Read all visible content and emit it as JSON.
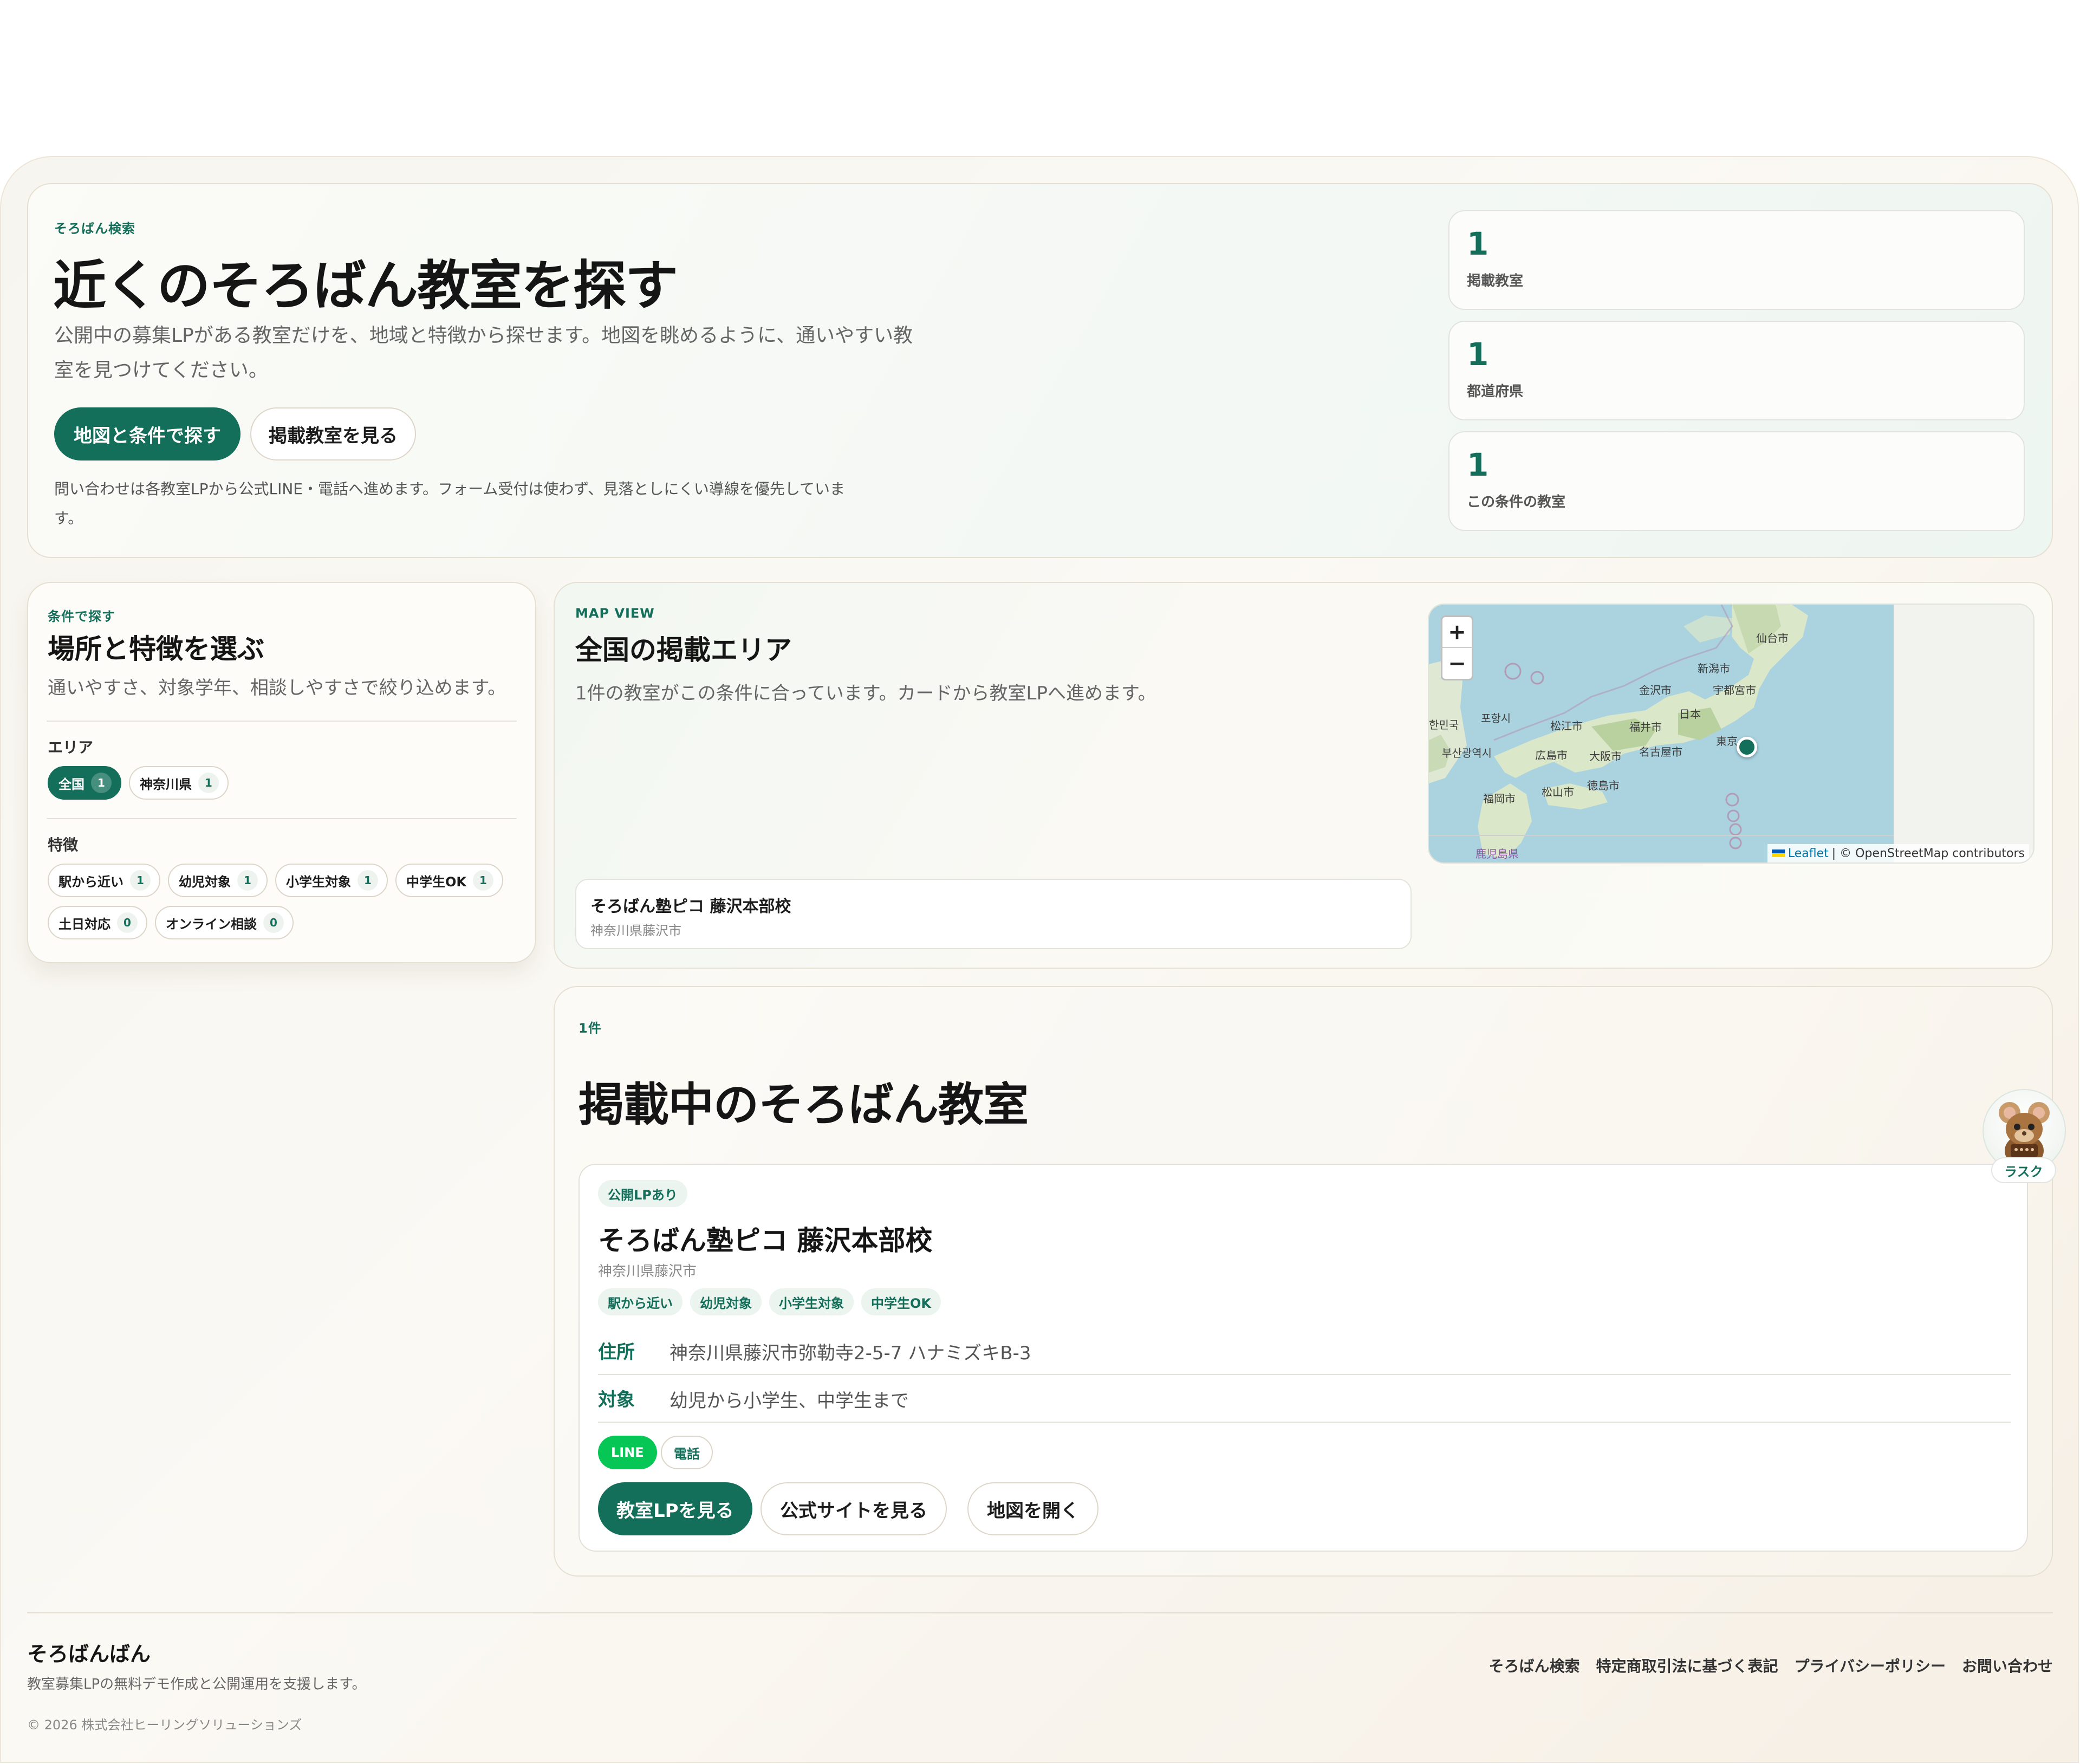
{
  "hero": {
    "eyebrow": "そろばん検索",
    "title": "近くのそろばん教室を探す",
    "lead_line1": "公開中の募集LPがある教室だけを、地域と特徴から探せます。地図を眺めるように、通いやすい教",
    "lead_line2": "室を見つけてください。",
    "primary_button": "地図と条件で探す",
    "secondary_button": "掲載教室を見る",
    "note_line1": "問い合わせは各教室LPから公式LINE・電話へ進めます。フォーム受付は使わず、見落としにくい導線を優先していま",
    "note_line2": "す。"
  },
  "stats": [
    {
      "value": "1",
      "label": "掲載教室"
    },
    {
      "value": "1",
      "label": "都道府県"
    },
    {
      "value": "1",
      "label": "この条件の教室"
    }
  ],
  "filters": {
    "eyebrow": "条件で探す",
    "title": "場所と特徴を選ぶ",
    "desc": "通いやすさ、対象学年、相談しやすさで絞り込めます。",
    "area_label": "エリア",
    "areas": [
      {
        "label": "全国",
        "count": "1",
        "active": true
      },
      {
        "label": "神奈川県",
        "count": "1",
        "active": false
      }
    ],
    "feature_label": "特徴",
    "features": [
      {
        "label": "駅から近い",
        "count": "1"
      },
      {
        "label": "幼児対象",
        "count": "1"
      },
      {
        "label": "小学生対象",
        "count": "1"
      },
      {
        "label": "中学生OK",
        "count": "1"
      },
      {
        "label": "土日対応",
        "count": "0"
      },
      {
        "label": "オンライン相談",
        "count": "0"
      }
    ]
  },
  "mapview": {
    "eyebrow": "MAP VIEW",
    "title": "全国の掲載エリア",
    "desc": "1件の教室がこの条件に合っています。カードから教室LPへ進めます。",
    "zoom_in": "+",
    "zoom_out": "−",
    "attribution_leaflet": "Leaflet",
    "attribution_rest": "| © OpenStreetMap contributors",
    "city_labels": [
      "仙台市",
      "新潟市",
      "金沢市",
      "宇都宮市",
      "日本",
      "福井市",
      "松江市",
      "東京",
      "名古屋市",
      "大阪市",
      "広島市",
      "徳島市",
      "松山市",
      "福岡市",
      "鹿児島県",
      "부산광역시",
      "포항시",
      "한민국"
    ],
    "mini_card": {
      "name": "そろばん塾ピコ 藤沢本部校",
      "location": "神奈川県藤沢市"
    }
  },
  "listing": {
    "count_label": "1件",
    "title": "掲載中のそろばん教室",
    "school": {
      "badge": "公開LPあり",
      "name": "そろばん塾ピコ 藤沢本部校",
      "location": "神奈川県藤沢市",
      "tags": [
        "駅から近い",
        "幼児対象",
        "小学生対象",
        "中学生OK"
      ],
      "address_label": "住所",
      "address": "神奈川県藤沢市弥勒寺2-5-7 ハナミズキB-3",
      "target_label": "対象",
      "target": "幼児から小学生、中学生まで",
      "contact_line": "LINE",
      "contact_phone": "電話",
      "btn_lp": "教室LPを見る",
      "btn_site": "公式サイトを見る",
      "btn_map": "地図を開く"
    }
  },
  "mascot": {
    "label": "ラスク"
  },
  "footer": {
    "brand": "そろばんばん",
    "tagline": "教室募集LPの無料デモ作成と公開運用を支援します。",
    "copyright": "© 2026 株式会社ヒーリングソリューションズ",
    "links": [
      "そろばん検索",
      "特定商取引法に基づく表記",
      "プライバシーポリシー",
      "お問い合わせ"
    ]
  },
  "colors": {
    "accent": "#136f5a",
    "line_green": "#06c755",
    "sea": "#aad3df",
    "land": "#e6eddc"
  }
}
